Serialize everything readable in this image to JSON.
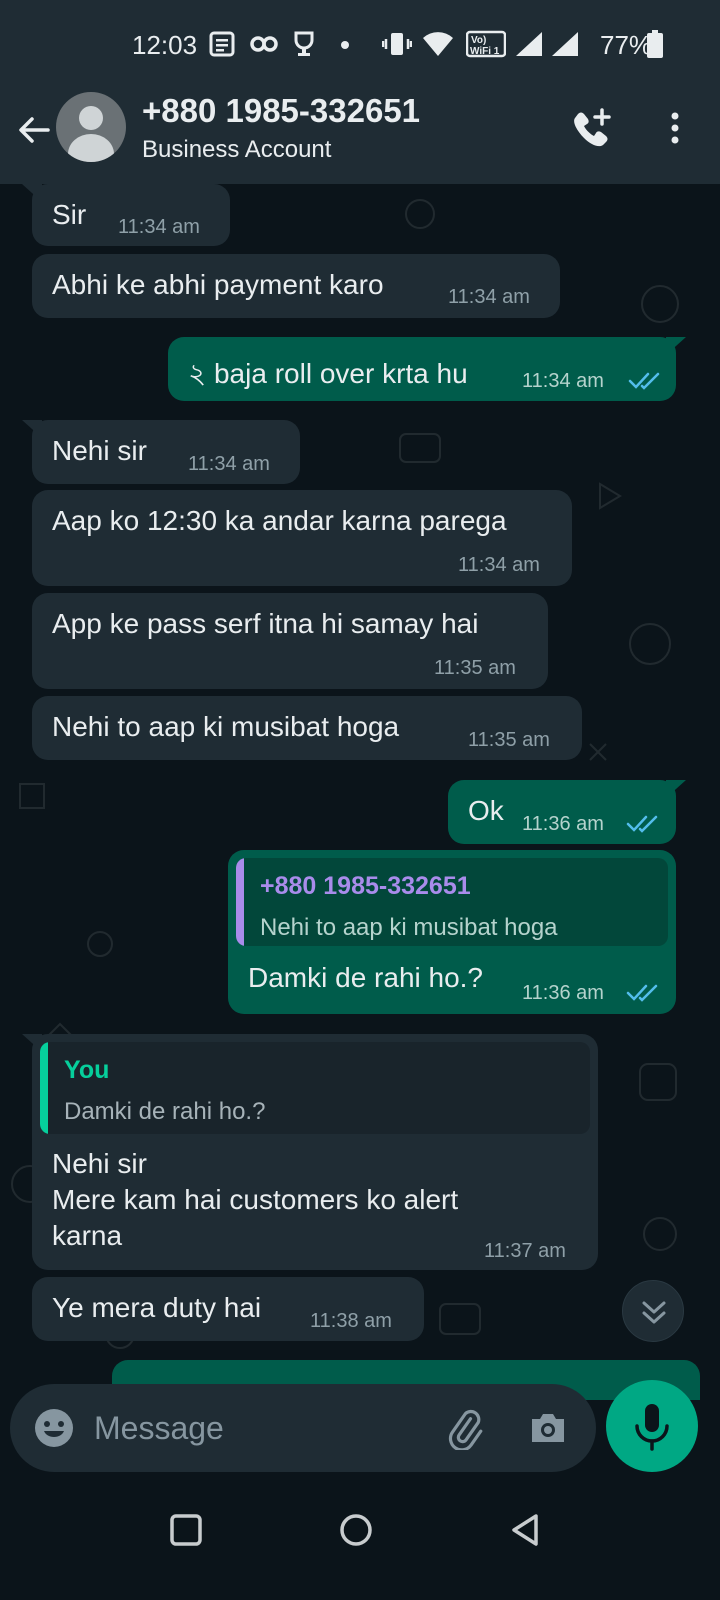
{
  "status_bar": {
    "time": "12:03",
    "battery": "77%",
    "icons": [
      "notes-icon",
      "link-icon",
      "trophy-icon",
      "dot-icon",
      "vibrate-icon",
      "wifi-icon",
      "vowifi-icon",
      "signal-icon",
      "signal-icon",
      "battery-icon"
    ]
  },
  "header": {
    "contact_name": "+880 1985-332651",
    "subtitle": "Business Account"
  },
  "messages": [
    {
      "dir": "in",
      "text": "Sir",
      "time": "11:34 am"
    },
    {
      "dir": "in",
      "text": "Abhi ke abhi payment karo",
      "time": "11:34 am"
    },
    {
      "dir": "out",
      "text": "২ baja roll  over krta hu",
      "time": "11:34 am"
    },
    {
      "dir": "in",
      "text": "Nehi sir",
      "time": "11:34 am"
    },
    {
      "dir": "in",
      "text": "Aap ko 12:30 ka andar karna parega",
      "time": "11:34 am"
    },
    {
      "dir": "in",
      "text": "App ke pass serf itna hi samay hai",
      "time": "11:35 am"
    },
    {
      "dir": "in",
      "text": "Nehi to aap ki musibat hoga",
      "time": "11:35 am"
    },
    {
      "dir": "out",
      "text": "Ok",
      "time": "11:36 am"
    },
    {
      "dir": "out",
      "quote_name": "+880 1985-332651",
      "quote_text": "Nehi to aap ki musibat hoga",
      "text": "Damki de rahi ho.?",
      "time": "11:36 am"
    },
    {
      "dir": "in",
      "quote_name": "You",
      "quote_text": "Damki de rahi ho.?",
      "line1": "Nehi sir",
      "line2": "Mere kam hai customers ko alert",
      "line3": "karna",
      "time": "11:37 am"
    },
    {
      "dir": "in",
      "text": "Ye mera duty hai",
      "time": "11:38 am"
    }
  ],
  "composer": {
    "placeholder": "Message"
  },
  "colors": {
    "header_bg": "#1f2c34",
    "chat_bg": "#0b141a",
    "incoming_bubble": "#1f2c34",
    "outgoing_bubble": "#005c4b",
    "accent": "#00a884",
    "read_ticks": "#53bdeb",
    "quote_purple": "#a98ceb",
    "quote_green": "#06cf9c"
  }
}
